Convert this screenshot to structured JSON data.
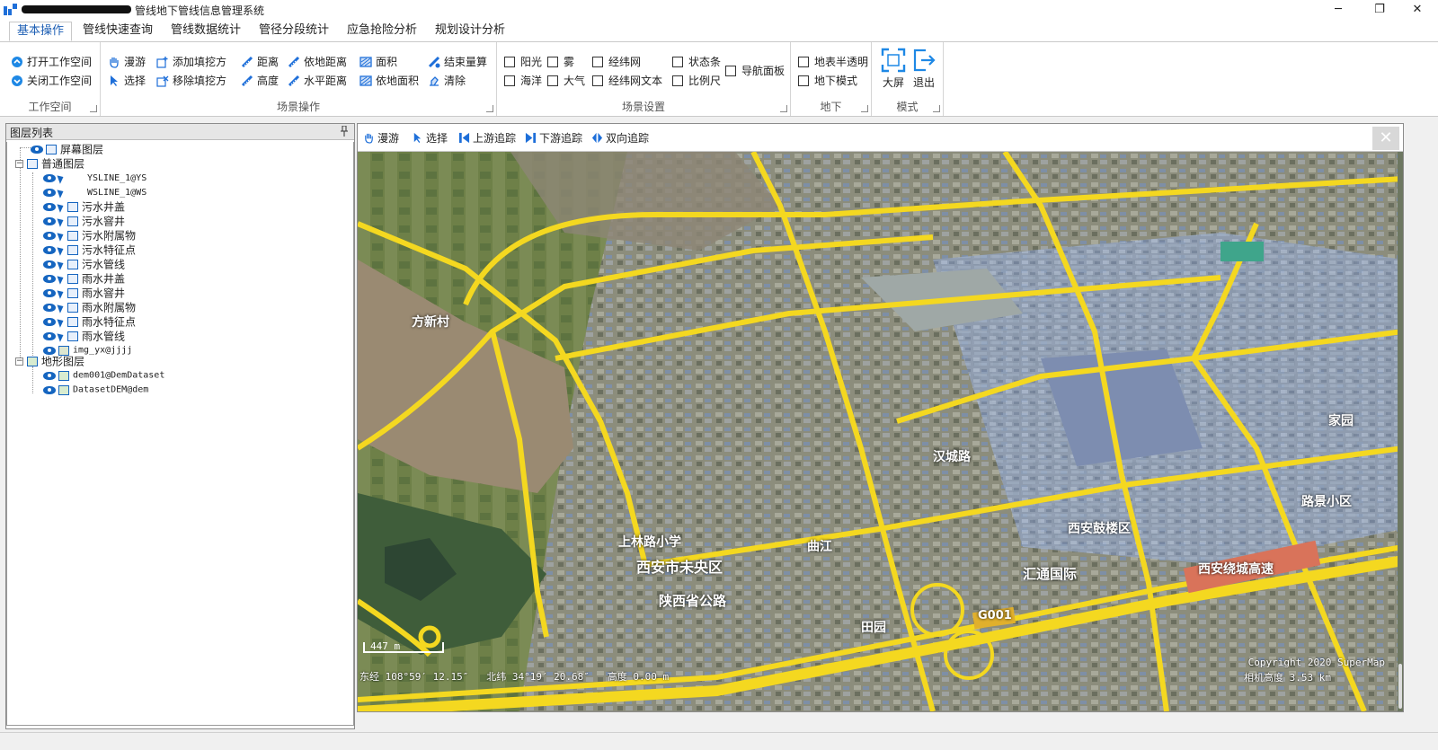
{
  "window": {
    "title": "管线地下管线信息管理系统",
    "minimize_glyph": "─",
    "restore_glyph": "❐",
    "close_glyph": "✕"
  },
  "tabs": [
    {
      "label": "基本操作",
      "active": true
    },
    {
      "label": "管线快速查询"
    },
    {
      "label": "管线数据统计"
    },
    {
      "label": "管径分段统计"
    },
    {
      "label": "应急抢险分析"
    },
    {
      "label": "规划设计分析"
    }
  ],
  "ribbon": {
    "workspace": {
      "label": "工作空间",
      "open": "打开工作空间",
      "close": "关闭工作空间"
    },
    "scene_ops": {
      "label": "场景操作",
      "pan": "漫游",
      "select": "选择",
      "add_cut": "添加填挖方",
      "remove_cut": "移除填挖方",
      "distance": "距离",
      "height": "高度",
      "ground_distance": "依地距离",
      "horizontal_distance": "水平距离",
      "area": "面积",
      "ground_area": "依地面积",
      "end_measure": "结束量算",
      "clear": "清除"
    },
    "scene_settings": {
      "label": "场景设置",
      "sunlight": "阳光",
      "fog": "雾",
      "ocean": "海洋",
      "atmosphere": "大气",
      "graticule": "经纬网",
      "graticule_text": "经纬网文本",
      "statusbar": "状态条",
      "scale": "比例尺",
      "nav_panel": "导航面板"
    },
    "underground": {
      "label": "地下",
      "transparent": "地表半透明",
      "mode": "地下模式"
    },
    "mode": {
      "label": "模式",
      "fullscreen": "大屏",
      "exit": "退出"
    }
  },
  "layer_panel": {
    "title": "图层列表",
    "screen_layers": "屏幕图层",
    "normal_layers": "普通图层",
    "normal_items": [
      "YSLINE_1@YS",
      "WSLINE_1@WS",
      "污水井盖",
      "污水窨井",
      "污水附属物",
      "污水特征点",
      "污水管线",
      "雨水井盖",
      "雨水窨井",
      "雨水附属物",
      "雨水特征点",
      "雨水管线",
      "img_yx@jjjj"
    ],
    "terrain_layers": "地形图层",
    "terrain_items": [
      "dem001@DemDataset",
      "DatasetDEM@dem"
    ]
  },
  "map_toolbar": {
    "pan": "漫游",
    "select": "选择",
    "upstream": "上游追踪",
    "downstream": "下游追踪",
    "bidirectional": "双向追踪"
  },
  "map": {
    "scale_label": "447 m",
    "status_line": "东经 108°59′ 12.15″   北纬 34°19′ 20.68″   高度 0.00 m",
    "copyright": "Copyright 2020 SuperMap",
    "camera_height": "相机高度 3.53 km",
    "labels": [
      "西安市未央区",
      "上林路小学",
      "陕西省公路",
      "曲江",
      "田园",
      "汉城路",
      "西安鼓楼区",
      "汇通国际",
      "西安绕城高速",
      "G001",
      "方新村",
      "路景小区",
      "家园"
    ]
  }
}
